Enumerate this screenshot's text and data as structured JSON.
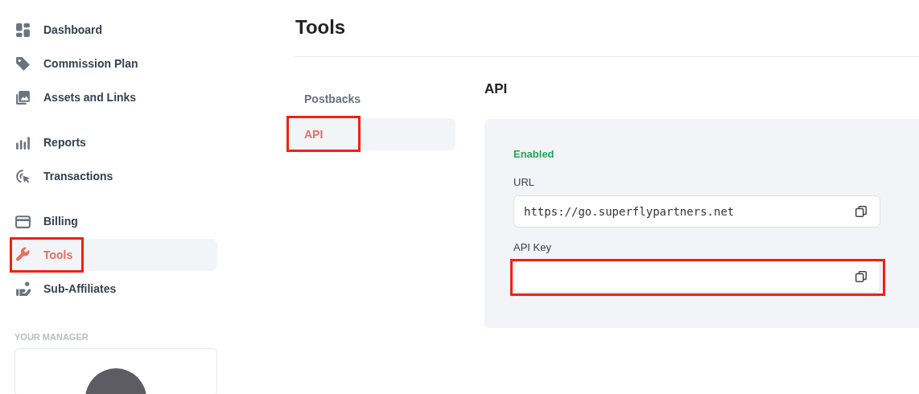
{
  "sidebar": {
    "groups": [
      {
        "items": [
          {
            "label": "Dashboard",
            "kind": "dashboard",
            "selected": false,
            "highlighted": false
          },
          {
            "label": "Commission Plan",
            "kind": "tag",
            "selected": false,
            "highlighted": false
          },
          {
            "label": "Assets and Links",
            "kind": "images",
            "selected": false,
            "highlighted": false
          }
        ]
      },
      {
        "items": [
          {
            "label": "Reports",
            "kind": "bars",
            "selected": false,
            "highlighted": false
          },
          {
            "label": "Transactions",
            "kind": "pointer",
            "selected": false,
            "highlighted": false
          }
        ]
      },
      {
        "items": [
          {
            "label": "Billing",
            "kind": "card",
            "selected": false,
            "highlighted": false
          },
          {
            "label": "Tools",
            "kind": "wrench",
            "selected": true,
            "highlighted": true
          },
          {
            "label": "Sub-Affiliates",
            "kind": "person",
            "selected": false,
            "highlighted": false
          }
        ]
      }
    ],
    "manager": {
      "heading": "YOUR MANAGER"
    }
  },
  "page": {
    "title": "Tools"
  },
  "tabs": [
    {
      "label": "Postbacks",
      "selected": false,
      "highlighted": false
    },
    {
      "label": "API",
      "selected": true,
      "highlighted": true
    }
  ],
  "api": {
    "heading": "API",
    "status": "Enabled",
    "fields": [
      {
        "label": "URL",
        "value": "https://go.superflypartners.net",
        "highlighted": false
      },
      {
        "label": "API Key",
        "highlighted": true
      }
    ]
  }
}
